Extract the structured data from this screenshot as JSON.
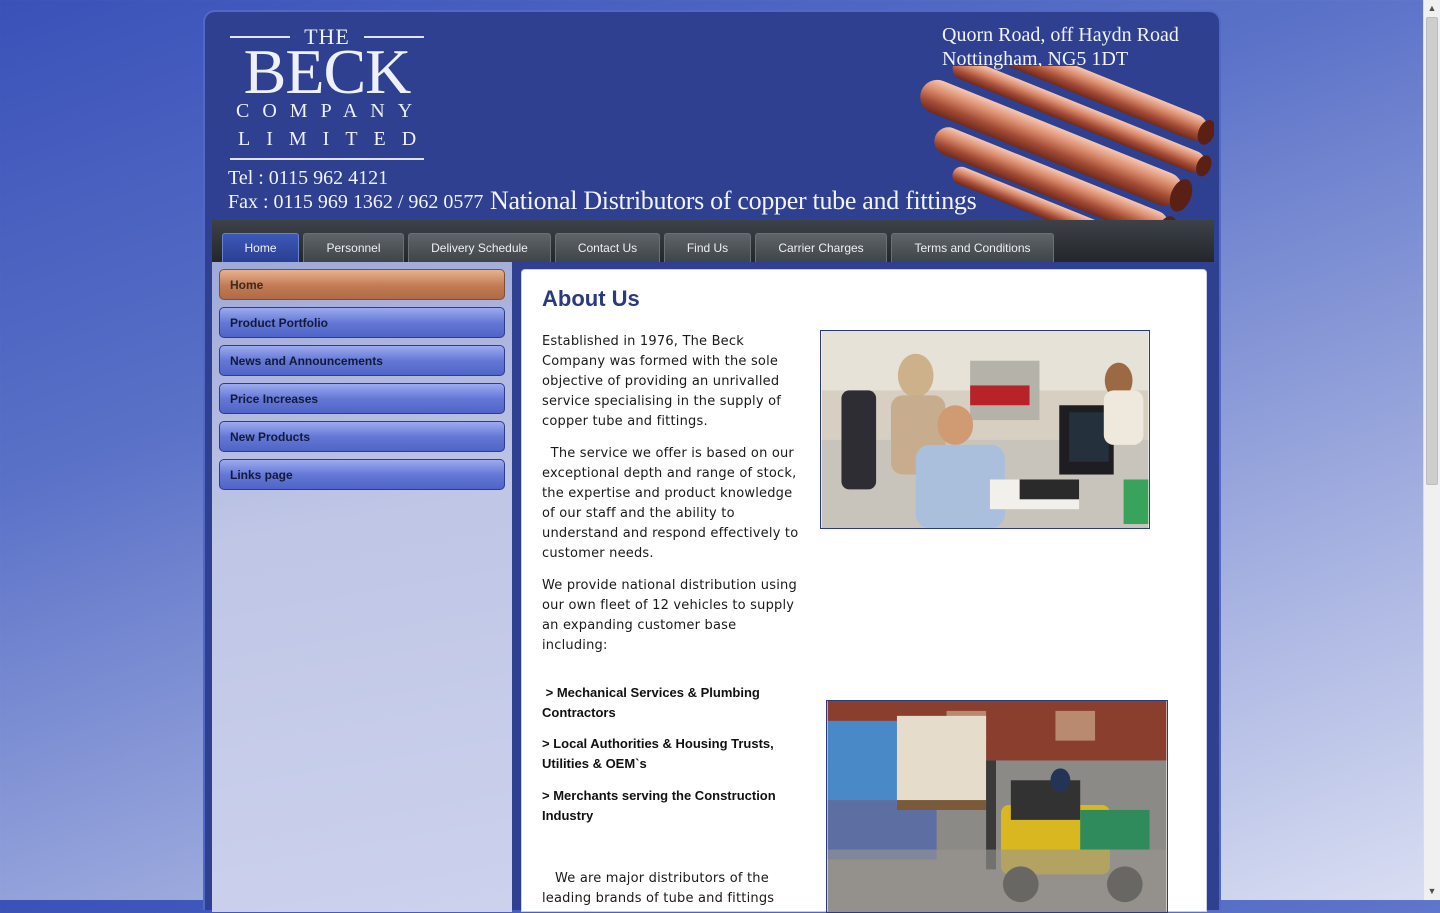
{
  "header": {
    "logo": {
      "the": "THE",
      "beck": "BECK",
      "company": "COMPANY",
      "limited": "LIMITED"
    },
    "tel": "Tel : 0115 962 4121",
    "fax": "Fax : 0115 969 1362 / 962 0577",
    "tagline": "National Distributors of copper tube and fittings",
    "address_line1": "Quorn Road, off Haydn Road",
    "address_line2": "Nottingham, NG5 1DT"
  },
  "nav": {
    "tabs": [
      {
        "label": "Home",
        "active": true
      },
      {
        "label": "Personnel"
      },
      {
        "label": "Delivery Schedule"
      },
      {
        "label": "Contact Us"
      },
      {
        "label": "Find Us"
      },
      {
        "label": "Carrier Charges"
      },
      {
        "label": "Terms and Conditions"
      }
    ]
  },
  "sidebar": {
    "items": [
      {
        "label": "Home",
        "active": true
      },
      {
        "label": "Product Portfolio"
      },
      {
        "label": "News and Announcements"
      },
      {
        "label": "Price Increases"
      },
      {
        "label": "New Products"
      },
      {
        "label": "Links page"
      }
    ]
  },
  "content": {
    "title": "About Us",
    "p1": "Established in 1976, The Beck Company was formed with the sole objective of providing an unrivalled service specialising in the supply of copper tube and fittings.",
    "p2": "  The service we offer is based on our exceptional depth and range of stock, the expertise and product knowledge of our staff and the ability to understand and respond effectively to customer needs.",
    "p3": "We provide national distribution using our own fleet of 12 vehicles to supply an expanding customer base including:",
    "customers": [
      " > Mechanical Services & Plumbing Contractors",
      "> Local Authorities & Housing Trusts, Utilities & OEM`s",
      "> Merchants serving the Construction Industry"
    ],
    "p4": "   We are major distributors of the leading brands of tube and fittings"
  },
  "colors": {
    "accent": "#2f4090",
    "title": "#2a3a7c",
    "active_side": "#c17a54"
  }
}
